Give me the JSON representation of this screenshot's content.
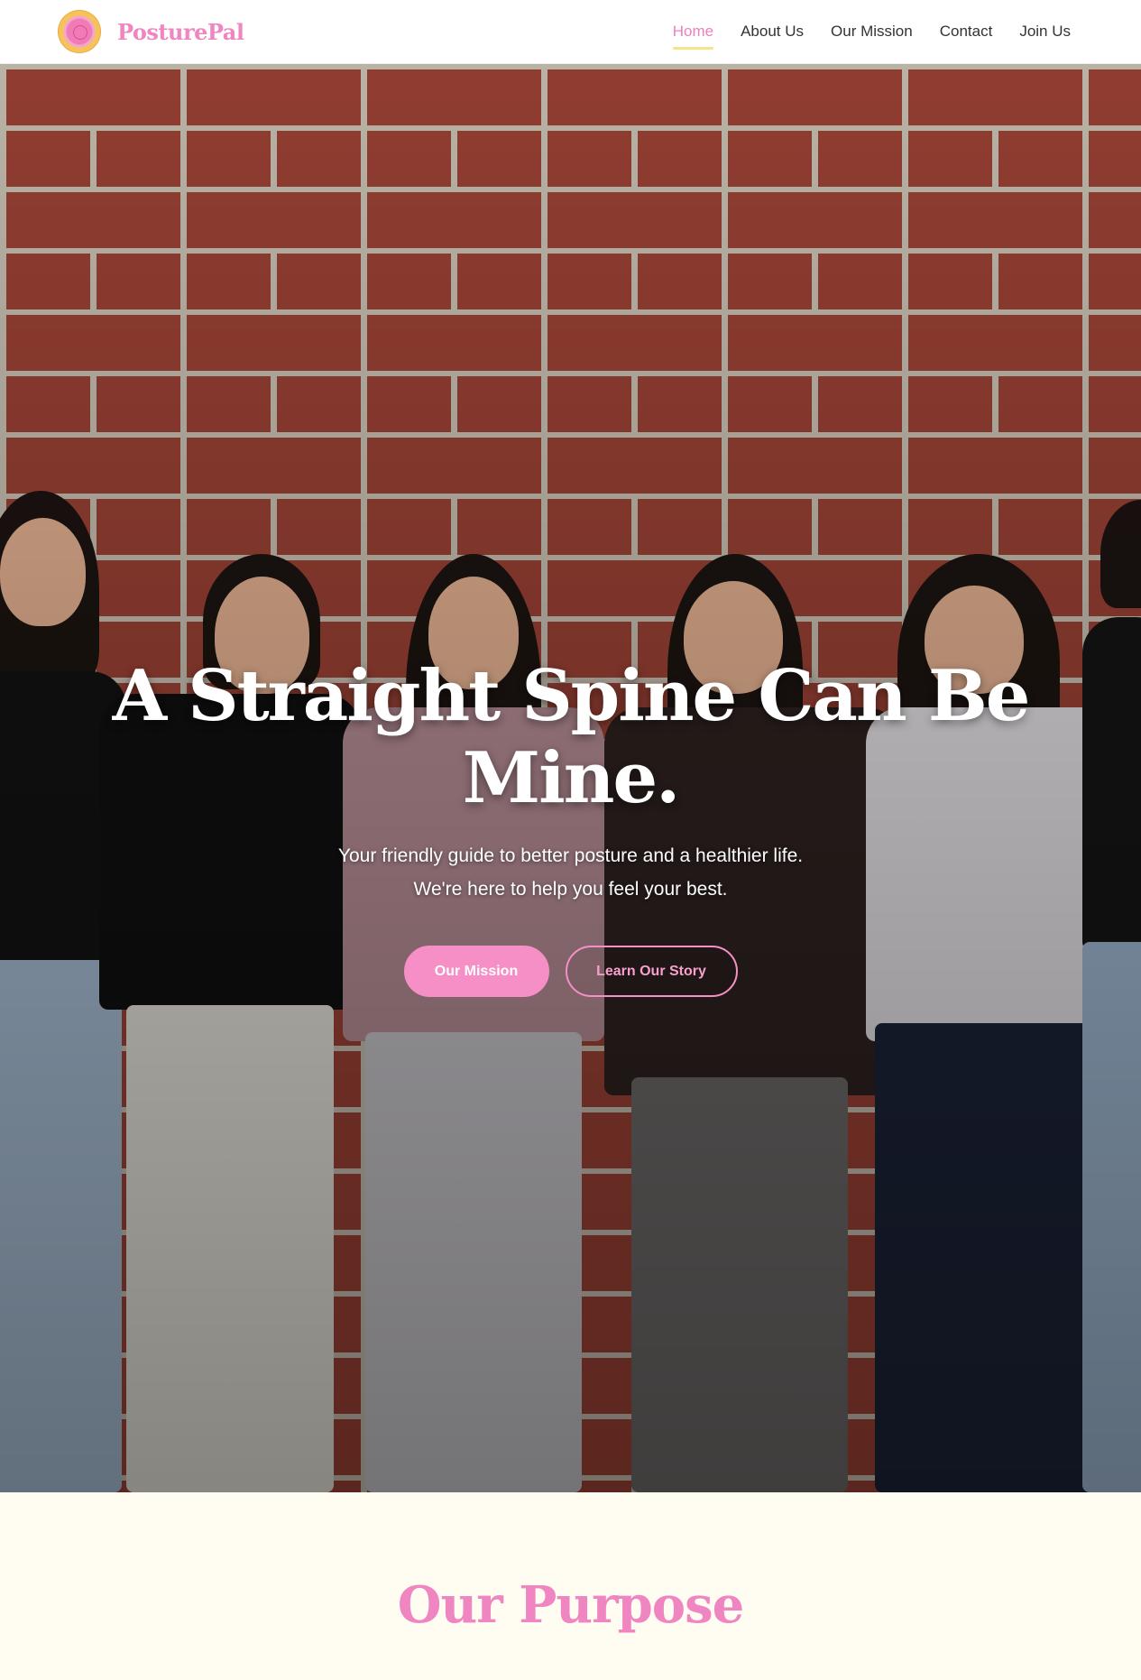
{
  "brand": {
    "name": "PosturePal",
    "logo_icon": "posturepal-logo-icon"
  },
  "nav": {
    "items": [
      {
        "label": "Home",
        "active": true
      },
      {
        "label": "About Us",
        "active": false
      },
      {
        "label": "Our Mission",
        "active": false
      },
      {
        "label": "Contact",
        "active": false
      },
      {
        "label": "Join Us",
        "active": false
      }
    ]
  },
  "hero": {
    "title": "A Straight Spine Can Be Mine.",
    "subtitle_line1": "Your friendly guide to better posture and a healthier life.",
    "subtitle_line2": "We're here to help you feel your best.",
    "primary_button": "Our Mission",
    "secondary_button": "Learn Our Story"
  },
  "purpose": {
    "title": "Our Purpose"
  },
  "colors": {
    "brand_pink": "#ef86c2",
    "button_pink": "#f58fc6",
    "active_underline": "#f4e48a",
    "section_bg": "#fffcf2"
  }
}
